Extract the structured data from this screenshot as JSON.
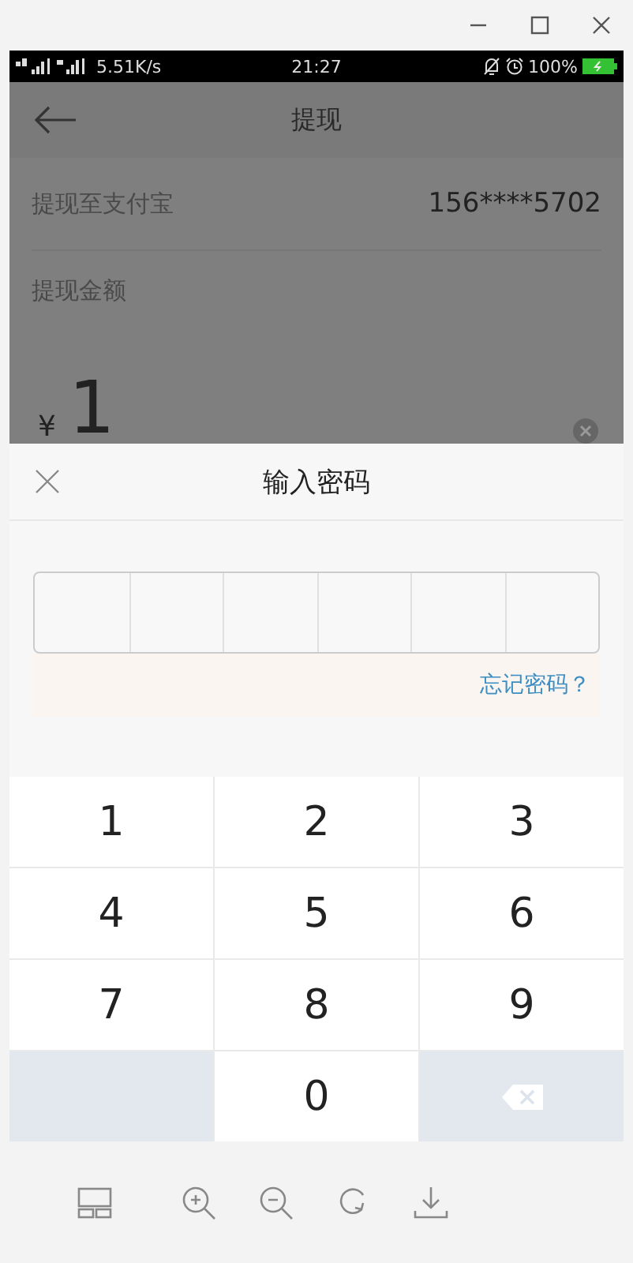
{
  "status_bar": {
    "speed": "5.51K/s",
    "time": "21:27",
    "battery": "100%"
  },
  "page": {
    "title": "提现",
    "account_label": "提现至支付宝",
    "account_value": "156****5702",
    "amount_label": "提现金额",
    "currency": "¥",
    "amount": "1"
  },
  "dialog": {
    "title": "输入密码",
    "pin_cells": [
      {
        "filled": false
      },
      {
        "filled": false
      },
      {
        "filled": false
      },
      {
        "filled": false
      },
      {
        "filled": false
      },
      {
        "filled": false
      }
    ],
    "forgot_link": "忘记密码？"
  },
  "keypad": [
    {
      "kind": "digit",
      "label": "1"
    },
    {
      "kind": "digit",
      "label": "2"
    },
    {
      "kind": "digit",
      "label": "3"
    },
    {
      "kind": "digit",
      "label": "4"
    },
    {
      "kind": "digit",
      "label": "5"
    },
    {
      "kind": "digit",
      "label": "6"
    },
    {
      "kind": "digit",
      "label": "7"
    },
    {
      "kind": "digit",
      "label": "8"
    },
    {
      "kind": "digit",
      "label": "9"
    },
    {
      "kind": "blank"
    },
    {
      "kind": "digit",
      "label": "0"
    },
    {
      "kind": "delete"
    }
  ]
}
